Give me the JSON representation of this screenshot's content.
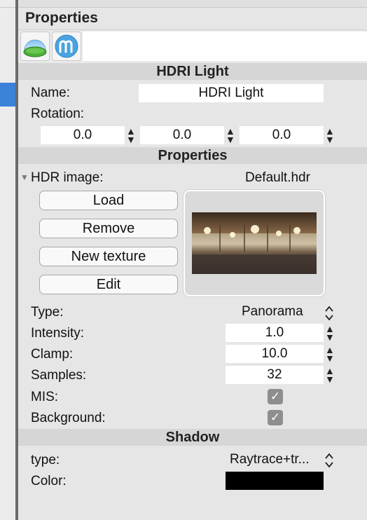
{
  "panel": {
    "title": "Properties"
  },
  "toolbar": {
    "tools": [
      {
        "icon": "environment-globe-icon"
      },
      {
        "icon": "m-logo-icon"
      }
    ]
  },
  "hdri_section": {
    "header": "HDRI Light",
    "name_label": "Name:",
    "name_value": "HDRI Light",
    "rotation_label": "Rotation:",
    "rotation": [
      "0.0",
      "0.0",
      "0.0"
    ]
  },
  "properties_section": {
    "header": "Properties",
    "hdr_label": "HDR image:",
    "hdr_value": "Default.hdr",
    "buttons": [
      "Load",
      "Remove",
      "New texture",
      "Edit"
    ],
    "type_label": "Type:",
    "type_value": "Panorama",
    "intensity_label": "Intensity:",
    "intensity_value": "1.0",
    "clamp_label": "Clamp:",
    "clamp_value": "10.0",
    "samples_label": "Samples:",
    "samples_value": "32",
    "mis_label": "MIS:",
    "mis_checked": true,
    "background_label": "Background:",
    "background_checked": true
  },
  "shadow_section": {
    "header": "Shadow",
    "type_label": "type:",
    "type_value": "Raytrace+tr...",
    "color_label": "Color:",
    "color_value": "#000000"
  },
  "colors": {
    "selection": "#3b82d8",
    "section_bg": "#d6d6d6",
    "checkbox": "#8e8e8e"
  }
}
